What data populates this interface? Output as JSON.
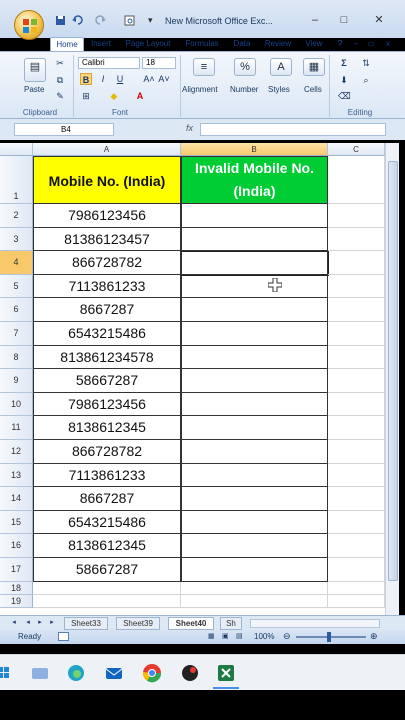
{
  "window": {
    "title": "New Microsoft Office Exc...",
    "minimize_glyph": "–",
    "maximize_glyph": "□",
    "close_glyph": "✕"
  },
  "ribbon": {
    "tabs": [
      {
        "label": "Home",
        "active": true
      },
      {
        "label": "Insert",
        "active": false
      },
      {
        "label": "Page Layout",
        "active": false
      },
      {
        "label": "Formulas",
        "active": false
      },
      {
        "label": "Data",
        "active": false
      },
      {
        "label": "Review",
        "active": false
      },
      {
        "label": "View",
        "active": false
      }
    ],
    "clipboard": {
      "paste_label": "Paste",
      "group_label": "Clipboard"
    },
    "font": {
      "name": "Calibri",
      "size": "18",
      "bold": "B",
      "italic": "I",
      "underline": "U",
      "grow": "A˄",
      "shrink": "A˅",
      "group_label": "Font"
    },
    "alignment_label": "Alignment",
    "number_label": "Number",
    "number_icon": "%",
    "styles_label": "Styles",
    "cells_label": "Cells",
    "editing_label": "Editing",
    "sigma": "Σ"
  },
  "formula_bar": {
    "name_box": "B4",
    "fx": "fx",
    "value": ""
  },
  "sheet": {
    "columns": [
      "A",
      "B",
      "C"
    ],
    "selected_column": "B",
    "selected_row": "4",
    "header_row": {
      "row": "1",
      "a": "Mobile No. (India)",
      "b": "Invalid Mobile No. (India)"
    },
    "rows": [
      {
        "row": "2",
        "a": "7986123456"
      },
      {
        "row": "3",
        "a": "81386123457"
      },
      {
        "row": "4",
        "a": "866728782"
      },
      {
        "row": "5",
        "a": "7113861233"
      },
      {
        "row": "6",
        "a": "8667287"
      },
      {
        "row": "7",
        "a": "6543215486"
      },
      {
        "row": "8",
        "a": "813861234578"
      },
      {
        "row": "9",
        "a": "58667287"
      },
      {
        "row": "10",
        "a": "7986123456"
      },
      {
        "row": "11",
        "a": "8138612345"
      },
      {
        "row": "12",
        "a": "866728782"
      },
      {
        "row": "13",
        "a": "7113861233"
      },
      {
        "row": "14",
        "a": "8667287"
      },
      {
        "row": "15",
        "a": "6543215486"
      },
      {
        "row": "16",
        "a": "8138612345"
      },
      {
        "row": "17",
        "a": "58667287"
      }
    ],
    "empty_rows": [
      "18",
      "19"
    ],
    "header_colors": {
      "a": "#ffff00",
      "b": "#00cc33",
      "b_text": "#ffffff"
    }
  },
  "sheet_tabs": [
    "Sheet33",
    "Sheet39",
    "Sheet40",
    "Sh"
  ],
  "active_sheet": "Sheet40",
  "status": {
    "ready": "Ready",
    "zoom": "100%"
  },
  "taskbar_icons": [
    "start-icon",
    "file-explorer-icon",
    "edge-icon",
    "mail-icon",
    "chrome-icon",
    "app-icon",
    "excel-icon"
  ]
}
